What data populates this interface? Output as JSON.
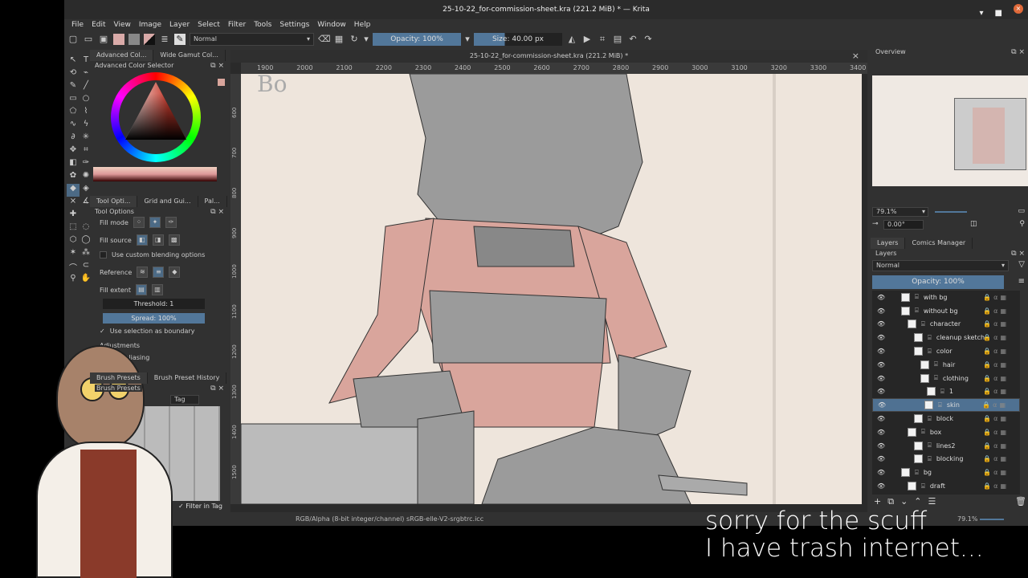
{
  "window": {
    "title": "25-10-22_for-commission-sheet.kra (221.2 MiB) * — Krita"
  },
  "menu": [
    "File",
    "Edit",
    "View",
    "Image",
    "Layer",
    "Select",
    "Filter",
    "Tools",
    "Settings",
    "Window",
    "Help"
  ],
  "toolbar": {
    "blend_mode": "Normal",
    "opacity": "Opacity: 100%",
    "size": "Size: 40.00 px"
  },
  "left_docker": {
    "color_tabs": [
      "Advanced Col...",
      "Wide Gamut Col..."
    ],
    "color_title": "Advanced Color Selector",
    "option_tabs": [
      "Tool Opti...",
      "Grid and Gui...",
      "Pal..."
    ],
    "tool_options_title": "Tool Options",
    "fill_mode": "Fill mode",
    "fill_source": "Fill source",
    "custom_blending": "Use custom blending options",
    "reference": "Reference",
    "fill_extent": "Fill extent",
    "threshold": "Threshold: 1",
    "spread": "Spread: 100%",
    "spread_value": 100,
    "selection_boundary": "Use selection as boundary",
    "adjustments": "Adjustments",
    "antialiasing": "Anti-aliasing",
    "brush_tabs": [
      "Brush Presets",
      "Brush Preset History"
    ],
    "brush_title": "Brush Presets",
    "brush_tag": "Tag",
    "filter_in_tag": "Filter in Tag"
  },
  "document": {
    "tab_title": "25-10-22_for-commission-sheet.kra (221.2 MiB) *",
    "hruler": [
      "1900",
      "2000",
      "2100",
      "2200",
      "2300",
      "2400",
      "2500",
      "2600",
      "2700",
      "2800",
      "2900",
      "3000",
      "3100",
      "3200",
      "3300",
      "3400"
    ],
    "vruler": [
      "600",
      "700",
      "800",
      "900",
      "1000",
      "1100",
      "1200",
      "1300",
      "1400",
      "1500"
    ]
  },
  "overview": {
    "title": "Overview",
    "zoom": "79.1%",
    "rotation": "0.00°"
  },
  "layers": {
    "tabs": [
      "Layers",
      "Comics Manager"
    ],
    "title": "Layers",
    "blend": "Normal",
    "opacity": "Opacity:  100%",
    "items": [
      {
        "name": "with bg",
        "depth": 0
      },
      {
        "name": "without bg",
        "depth": 0
      },
      {
        "name": "character",
        "depth": 1
      },
      {
        "name": "cleanup sketch",
        "depth": 2
      },
      {
        "name": "color",
        "depth": 2
      },
      {
        "name": "hair",
        "depth": 3
      },
      {
        "name": "clothing",
        "depth": 3
      },
      {
        "name": "1",
        "depth": 4
      },
      {
        "name": "skin",
        "depth": 3
      },
      {
        "name": "block",
        "depth": 2
      },
      {
        "name": "box",
        "depth": 1
      },
      {
        "name": "lines2",
        "depth": 2
      },
      {
        "name": "blocking",
        "depth": 2
      },
      {
        "name": "bg",
        "depth": 0
      },
      {
        "name": "draft",
        "depth": 1
      }
    ],
    "selected": "skin"
  },
  "status": {
    "color_space": "RGB/Alpha (8-bit integer/channel)  sRGB-elle-V2-srgbtrc.icc",
    "zoom": "79.1%"
  },
  "caption": {
    "line1": "sorry for the scuff",
    "line2": "I have trash internet..."
  },
  "colors": {
    "accent": "#52779a",
    "canvas": "#eee5dc",
    "skin": "#d9a59c"
  }
}
